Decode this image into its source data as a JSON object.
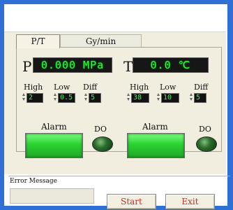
{
  "tabs": [
    {
      "label": "P/T",
      "active": true
    },
    {
      "label": "Gy/min",
      "active": false
    }
  ],
  "pressure": {
    "label": "P",
    "display": "0.000 MPa",
    "high_label": "High",
    "low_label": "Low",
    "diff_label": "Diff",
    "high": "2",
    "low": "0.5",
    "diff": "5",
    "alarm_label": "Alarm",
    "do_label": "DO"
  },
  "temperature": {
    "label": "T",
    "display": "0.0 ℃",
    "high_label": "High",
    "low_label": "Low",
    "diff_label": "Diff",
    "high": "38",
    "low": "10",
    "diff": "5",
    "alarm_label": "Alarm",
    "do_label": "DO"
  },
  "error": {
    "label": "Error Message",
    "value": ""
  },
  "buttons": {
    "start": "Start",
    "exit": "Exit"
  },
  "colors": {
    "window_border": "#2f6fd6",
    "lcd_text": "#27ff3a",
    "lcd_bg": "#161616",
    "alarm_green": "#2ad232",
    "button_text": "#d32424",
    "panel_bg": "#f1eedf"
  },
  "icons": {
    "spin_up": "triangle-up",
    "spin_down": "triangle-down",
    "do_led": "green-led"
  }
}
